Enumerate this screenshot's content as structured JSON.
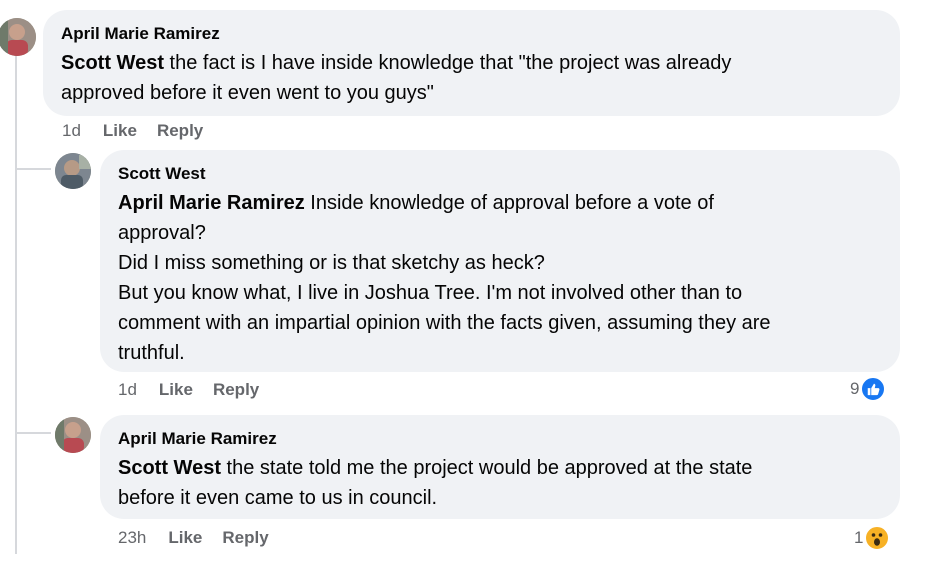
{
  "comments": [
    {
      "author": "April Marie Ramirez",
      "mention": "Scott West",
      "lines": [
        " the fact is I have inside knowledge that \"the project was already",
        "approved before it even went to you guys\""
      ],
      "time": "1d",
      "like_label": "Like",
      "reply_label": "Reply"
    },
    {
      "author": "Scott West",
      "mention": "April Marie Ramirez",
      "lines": [
        " Inside knowledge of approval before a vote of",
        "approval?",
        "Did I miss something or is that sketchy as heck?",
        "But you know what, I live in Joshua Tree. I'm not involved other than to",
        "comment with an impartial opinion with the facts given, assuming they are",
        "truthful."
      ],
      "time": "1d",
      "like_label": "Like",
      "reply_label": "Reply",
      "reaction_count": "9",
      "reaction_icon": "like-icon"
    },
    {
      "author": "April Marie Ramirez",
      "mention": "Scott West",
      "lines": [
        " the state told me the project would be approved at the state",
        "before it even came to us in council."
      ],
      "time": "23h",
      "like_label": "Like",
      "reply_label": "Reply",
      "reaction_count": "1",
      "reaction_icon": "wow-icon"
    }
  ],
  "colors": {
    "bubble": "#f0f2f5",
    "like_blue": "#1877f2",
    "wow_yellow": "#f7b125",
    "meta_gray": "#65676b"
  }
}
